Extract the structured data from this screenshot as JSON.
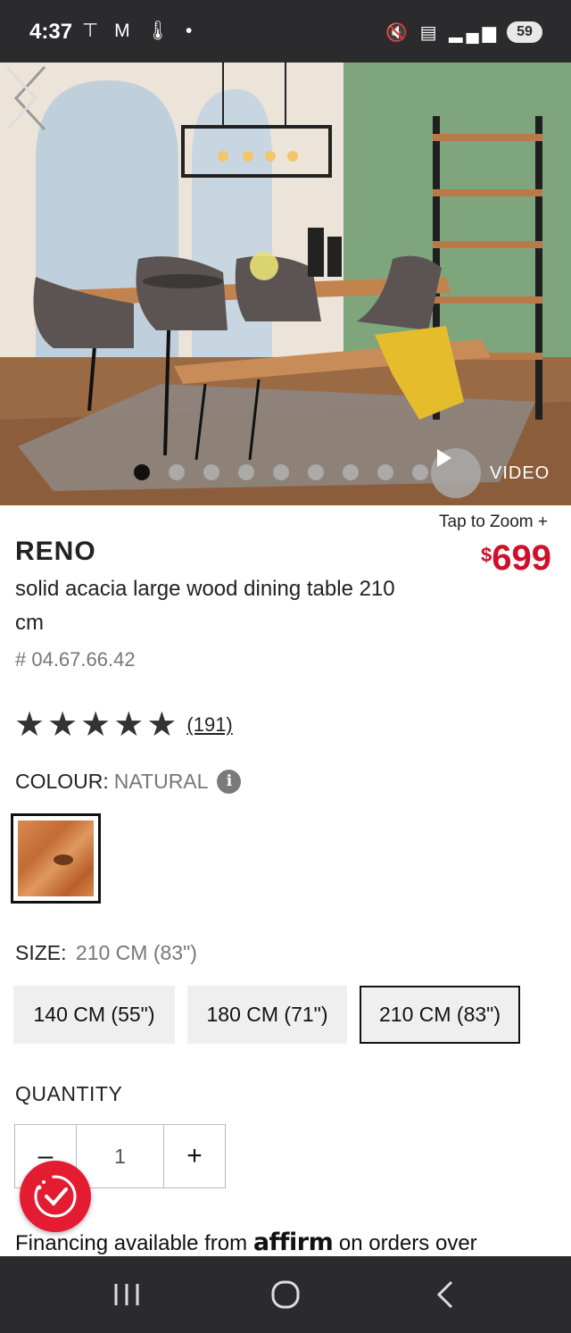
{
  "status_bar": {
    "time": "4:37",
    "left_icons": "⊤ M 🌡 •",
    "right_icons": "🔇 ▤ ▂▄▆",
    "battery": "59"
  },
  "hero": {
    "video_label": "VIDEO",
    "slide_count": 9,
    "active_slide": 1
  },
  "product": {
    "tap_to_zoom": "Tap to Zoom +",
    "price_symbol": "$",
    "price": "699",
    "brand": "RENO",
    "description": "solid acacia large wood dining table 210 cm",
    "sku": "# 04.67.66.42",
    "rating_stars": 5,
    "review_count": "(191)"
  },
  "colour": {
    "label": "COLOUR:",
    "value": "NATURAL",
    "info_icon": "i"
  },
  "size": {
    "label": "SIZE:",
    "value": "210 CM (83\")",
    "options": [
      {
        "label": "140 CM (55\")",
        "selected": false
      },
      {
        "label": "180 CM (71\")",
        "selected": false
      },
      {
        "label": "210 CM (83\")",
        "selected": true
      }
    ]
  },
  "quantity": {
    "label": "QUANTITY",
    "minus": "–",
    "value": "1",
    "plus": "+"
  },
  "financing": {
    "prefix": "Financing available from",
    "brand": "affirm",
    "suffix": "on orders over"
  },
  "colors": {
    "accent_red": "#d0102a",
    "status_bar_bg": "#2b2b2d"
  }
}
